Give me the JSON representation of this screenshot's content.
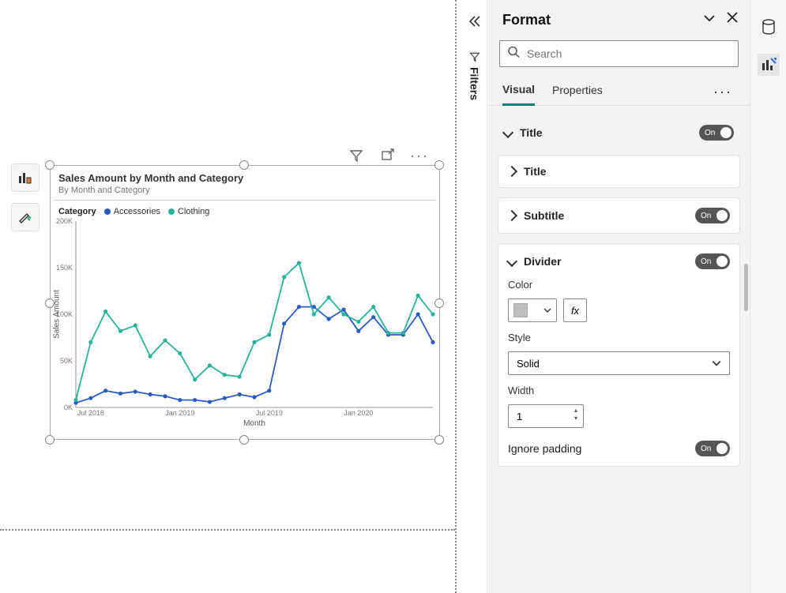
{
  "rail_label": "Filters",
  "format": {
    "title": "Format",
    "search_placeholder": "Search",
    "tabs": {
      "visual": "Visual",
      "properties": "Properties"
    },
    "sections": {
      "title": {
        "label": "Title",
        "toggle": "On"
      },
      "title_inner": {
        "label": "Title"
      },
      "subtitle": {
        "label": "Subtitle",
        "toggle": "On"
      },
      "divider": {
        "label": "Divider",
        "toggle": "On",
        "color_label": "Color",
        "fx": "fx",
        "style_label": "Style",
        "style_value": "Solid",
        "width_label": "Width",
        "width_value": "1",
        "ignore_padding_label": "Ignore padding",
        "ignore_padding_toggle": "On"
      }
    }
  },
  "chart": {
    "title": "Sales Amount by Month and Category",
    "subtitle": "By Month and Category",
    "legend_label": "Category",
    "series_names": {
      "a": "Accessories",
      "b": "Clothing"
    },
    "yticks": [
      "0K",
      "50K",
      "100K",
      "150K",
      "200K"
    ],
    "xticks": [
      "Jul 2018",
      "Jan 2019",
      "Jul 2019",
      "Jan 2020"
    ],
    "xlabel": "Month",
    "ylabel": "Sales Amount"
  },
  "chart_data": {
    "type": "line",
    "xlabel": "Month",
    "ylabel": "Sales Amount",
    "ylim": [
      0,
      200000
    ],
    "title": "Sales Amount by Month and Category",
    "subtitle": "By Month and Category",
    "x": [
      "2018-06",
      "2018-07",
      "2018-08",
      "2018-09",
      "2018-10",
      "2018-11",
      "2018-12",
      "2019-01",
      "2019-02",
      "2019-03",
      "2019-04",
      "2019-05",
      "2019-06",
      "2019-07",
      "2019-08",
      "2019-09",
      "2019-10",
      "2019-11",
      "2019-12",
      "2020-01",
      "2020-02",
      "2020-03",
      "2020-04",
      "2020-05",
      "2020-06"
    ],
    "series": [
      {
        "name": "Accessories",
        "color": "#2b5cc4",
        "values": [
          5,
          10,
          18,
          15,
          17,
          14,
          12,
          8,
          8,
          6,
          10,
          14,
          11,
          18,
          90,
          108,
          108,
          95,
          105,
          82,
          97,
          78,
          78,
          100,
          70
        ]
      },
      {
        "name": "Clothing",
        "color": "#27b39b",
        "values": [
          8,
          70,
          103,
          82,
          88,
          55,
          72,
          58,
          30,
          45,
          35,
          33,
          70,
          78,
          140,
          155,
          100,
          118,
          100,
          92,
          108,
          80,
          80,
          120,
          100
        ]
      }
    ],
    "note": "series values are in thousands (K)"
  }
}
